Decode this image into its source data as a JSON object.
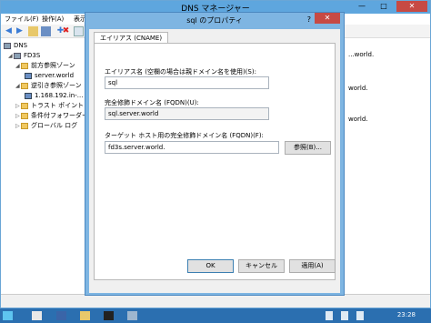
{
  "main_window": {
    "title": "DNS マネージャー",
    "controls": {
      "minimize": "—",
      "maximize": "□",
      "close": "✕"
    },
    "menu": [
      "ファイル(F)",
      "操作(A)",
      "表示"
    ],
    "tree": {
      "root": "DNS",
      "server": "FD3S",
      "forward_zones": "前方参照ゾーン",
      "forward_zone_item": "server.world",
      "reverse_zones": "逆引き参照ゾーン",
      "reverse_zone_item": "1.168.192.in-...",
      "trust_points": "トラスト ポイント",
      "conditional_forwarders": "条件付フォワーダー",
      "global_logs": "グローバル ログ"
    },
    "right_pane": [
      "...world.",
      "world.",
      "world."
    ]
  },
  "dialog": {
    "title": "sql のプロパティ",
    "help": "?",
    "close": "✕",
    "tab": "エイリアス (CNAME)",
    "alias_label": "エイリアス名 (空欄の場合は親ドメイン名を使用)(S):",
    "alias_value": "sql",
    "fqdn_label": "完全修飾ドメイン名 (FQDN)(U):",
    "fqdn_value": "sql.server.world",
    "target_label": "ターゲット ホスト用の完全修飾ドメイン名 (FQDN)(F):",
    "target_value": "fd3s.server.world.",
    "browse_button": "参照(B)...",
    "ok_button": "OK",
    "cancel_button": "キャンセル",
    "apply_button": "適用(A)"
  },
  "taskbar": {
    "clock": "23:28"
  },
  "colors": {
    "titlebar": "#5ea6de",
    "dialog_frame": "#7eb5e2",
    "close_red": "#c74a44",
    "taskbar": "#2b6fb0"
  }
}
